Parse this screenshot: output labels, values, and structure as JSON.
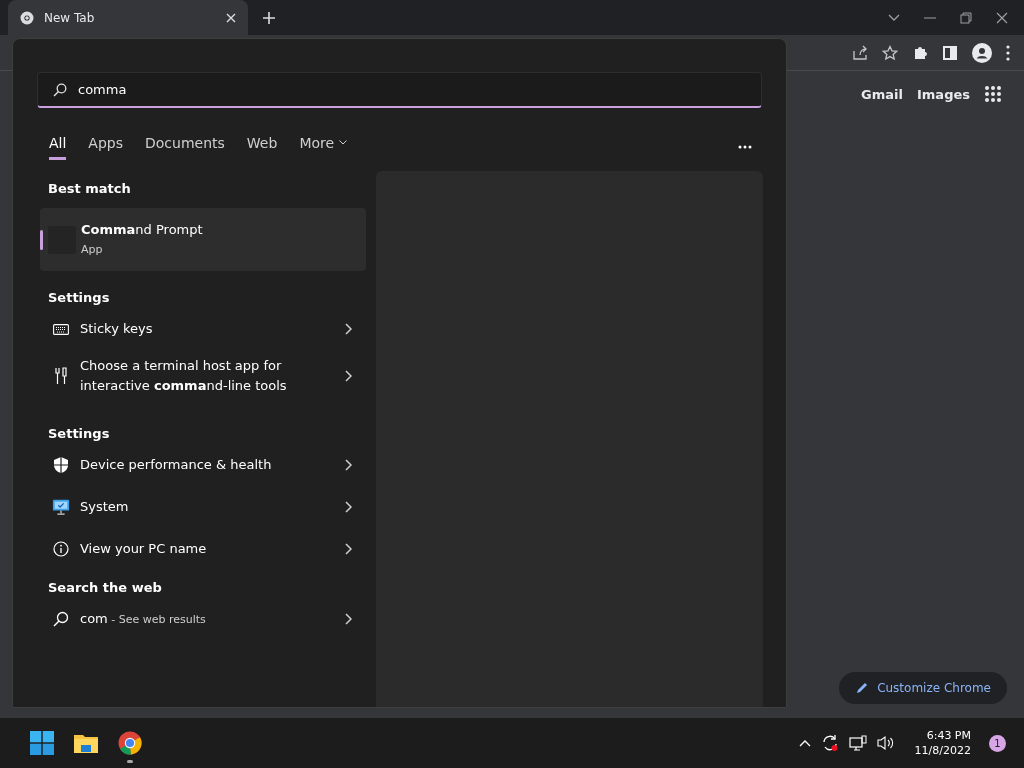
{
  "browser": {
    "tab": {
      "title": "New Tab"
    },
    "links": [
      "Gmail",
      "Images"
    ],
    "customize_button": "Customize Chrome"
  },
  "search": {
    "query": "comma",
    "filters": [
      {
        "label": "All",
        "selected": true,
        "kind": "tab"
      },
      {
        "label": "Apps",
        "selected": false,
        "kind": "tab"
      },
      {
        "label": "Documents",
        "selected": false,
        "kind": "tab"
      },
      {
        "label": "Web",
        "selected": false,
        "kind": "tab"
      },
      {
        "label": "More",
        "selected": false,
        "kind": "dropdown"
      }
    ],
    "sections": [
      {
        "heading": "Best match",
        "items": [
          {
            "kind": "app",
            "title": "**Comma**nd Prompt",
            "subtitle": "App",
            "selected": true
          }
        ]
      },
      {
        "heading": "Settings",
        "items": [
          {
            "kind": "setting",
            "title": "Sticky keys",
            "selected": false
          },
          {
            "kind": "setting",
            "title": "Choose a terminal host app for interactive **comma**nd-line tools",
            "selected": false
          }
        ]
      },
      {
        "heading": "Settings",
        "items": [
          {
            "kind": "setting",
            "title": "Device performance & health",
            "selected": false
          },
          {
            "kind": "setting",
            "title": "System",
            "selected": false
          },
          {
            "kind": "setting",
            "title": "View your PC name",
            "selected": false
          }
        ]
      },
      {
        "heading": "Search the web",
        "items": [
          {
            "kind": "web",
            "title": "com",
            "subtitle": "- See web results",
            "selected": false
          }
        ]
      }
    ]
  },
  "taskbar": {
    "apps": [
      {
        "running": false
      },
      {
        "running": false
      },
      {
        "running": true
      }
    ],
    "time": "6:43 PM",
    "date": "11/8/2022",
    "notification_count": "1"
  }
}
